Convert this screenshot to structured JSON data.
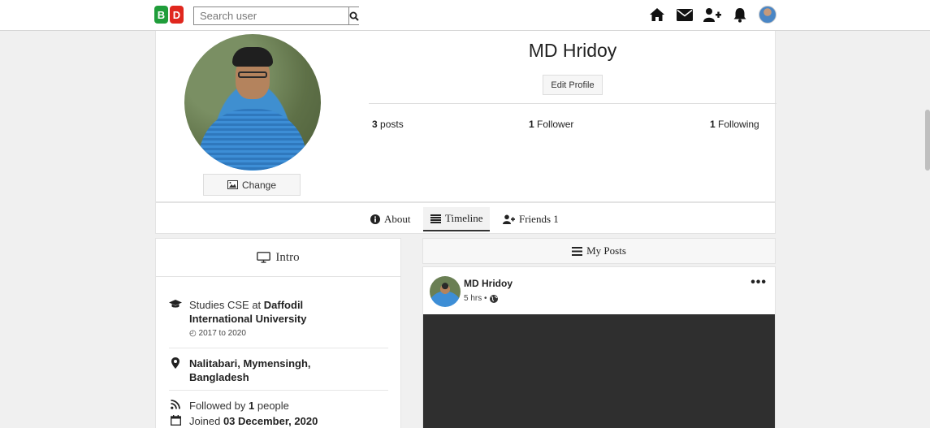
{
  "logo": {
    "b": "B",
    "d": "D",
    "colors": {
      "b": "#1f9d3a",
      "d": "#e0271e"
    }
  },
  "search": {
    "placeholder": "Search user",
    "value": ""
  },
  "nav": {
    "icons": [
      "home-icon",
      "envelope-icon",
      "user-plus-icon",
      "bell-icon",
      "avatar"
    ]
  },
  "profile": {
    "name": "MD Hridoy",
    "change_label": "Change",
    "edit_label": "Edit Profile",
    "posts": {
      "count": "3",
      "label": "posts"
    },
    "followers": {
      "count": "1",
      "label": "Follower"
    },
    "following": {
      "count": "1",
      "label": "Following"
    }
  },
  "tabs": [
    {
      "label": "About",
      "icon": "info-circle-icon"
    },
    {
      "label": "Timeline",
      "icon": "list-icon",
      "active": true
    },
    {
      "label": "Friends 1",
      "icon": "user-plus-icon"
    }
  ],
  "intro": {
    "title": "Intro",
    "study_prefix": "Studies CSE at",
    "study_school_line1": "Daffodil",
    "study_school_line2": "International University",
    "study_years": "2017 to 2020",
    "location_line1": "Nalitabari, Mymensingh,",
    "location_line2": "Bangladesh",
    "followed_prefix": "Followed by",
    "followed_count": "1",
    "followed_suffix": "people",
    "joined_prefix": "Joined",
    "joined_date": "03 December, 2020"
  },
  "posts_section": {
    "title": "My Posts",
    "post": {
      "author": "MD Hridoy",
      "time": "5 hrs •",
      "menu": "•••"
    }
  }
}
